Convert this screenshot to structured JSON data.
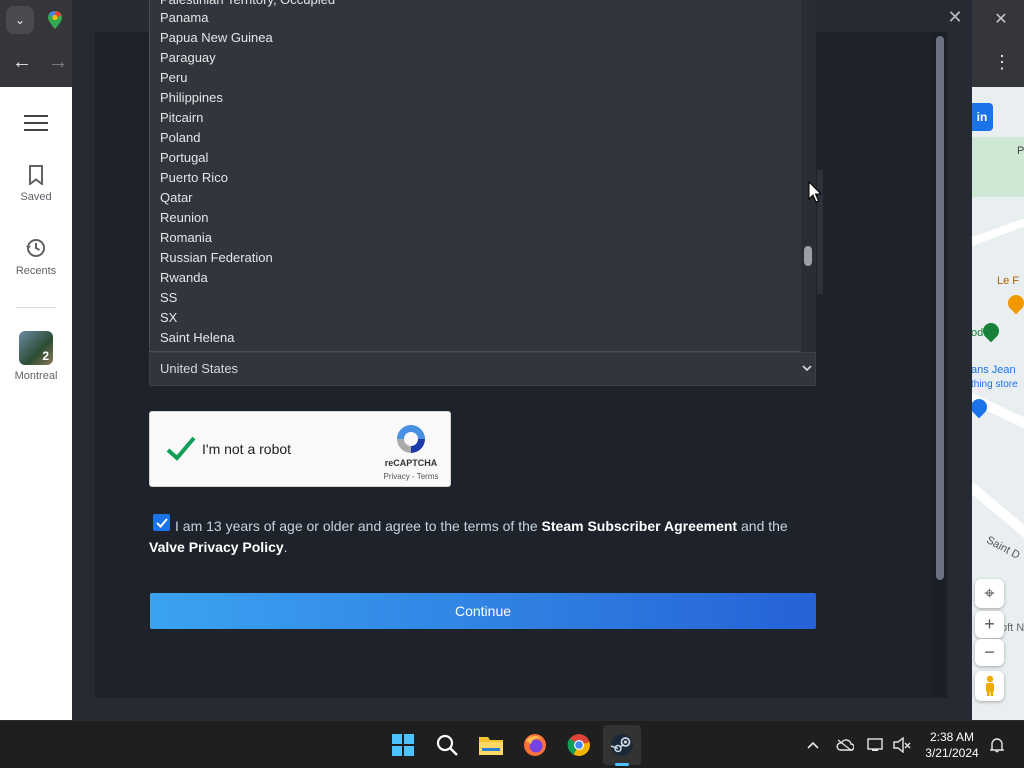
{
  "browser": {
    "tab_dropdown_icon": "chevron-down-icon",
    "close_glyph": "✕",
    "back_glyph": "←",
    "forward_glyph": "→",
    "menu_glyph": "⋮"
  },
  "maps_sidebar": {
    "items": [
      {
        "label": "Saved",
        "icon": "bookmark-icon"
      },
      {
        "label": "Recents",
        "icon": "history-icon"
      }
    ],
    "recent_place": {
      "label": "Montreal",
      "badge": "2"
    }
  },
  "map": {
    "signin_label": "in",
    "labels": [
      "P",
      "Le F",
      "od",
      "ans Jean",
      "thing store",
      "Saint D",
      "oft N"
    ],
    "controls": {
      "zoom_in": "+",
      "zoom_out": "−"
    }
  },
  "steam_dialog": {
    "close_glyph": "✕",
    "partial_top_item": "Palestinian Territory, Occupied",
    "countries": [
      "Panama",
      "Papua New Guinea",
      "Paraguay",
      "Peru",
      "Philippines",
      "Pitcairn",
      "Poland",
      "Portugal",
      "Puerto Rico",
      "Qatar",
      "Reunion",
      "Romania",
      "Russian Federation",
      "Rwanda",
      "SS",
      "SX",
      "Saint Helena"
    ],
    "selected_country": "United States",
    "recaptcha": {
      "label": "I'm not a robot",
      "brand": "reCAPTCHA",
      "links": "Privacy - Terms",
      "checked": true
    },
    "agreement": {
      "prefix": "I am 13 years of age or older and agree to the terms of the ",
      "link1": "Steam Subscriber Agreement",
      "middle": " and the ",
      "link2": "Valve Privacy Policy",
      "suffix": ".",
      "checked": true
    },
    "continue_label": "Continue"
  },
  "taskbar": {
    "apps": [
      "windows-start-icon",
      "search-icon",
      "file-explorer-icon",
      "firefox-icon",
      "chrome-icon",
      "steam-icon"
    ],
    "active_app": "steam-icon",
    "time": "2:38 AM",
    "date": "3/21/2024"
  },
  "colors": {
    "dialog_bg": "#252a33",
    "list_bg": "#32353d",
    "continue_gradient_start": "#3aa3f2",
    "continue_gradient_end": "#2562d6",
    "checkbox_accent": "#1a73e8"
  }
}
